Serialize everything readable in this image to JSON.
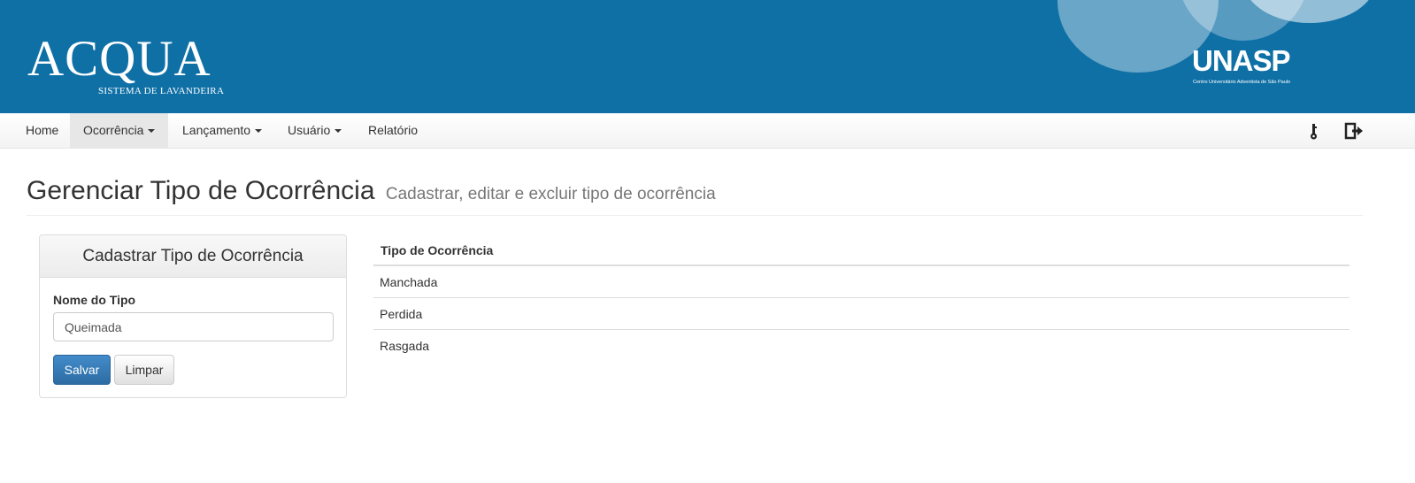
{
  "header": {
    "logo_title": "ACQUA",
    "logo_subtitle": "SISTEMA DE LAVANDEIRA",
    "partner_logo": "UNASP",
    "partner_caption": "Centro Universitário Adventista de São Paulo",
    "background_color": "#0f70a6"
  },
  "navbar": {
    "items": [
      {
        "label": "Home",
        "dropdown": false,
        "active": false
      },
      {
        "label": "Ocorrência",
        "dropdown": true,
        "active": true
      },
      {
        "label": "Lançamento",
        "dropdown": true,
        "active": false
      },
      {
        "label": "Usuário",
        "dropdown": true,
        "active": false
      },
      {
        "label": "Relatório",
        "dropdown": false,
        "active": false
      }
    ],
    "right_icons": [
      "key-icon",
      "logout-icon"
    ]
  },
  "page": {
    "title": "Gerenciar Tipo de Ocorrência",
    "subtitle": "Cadastrar, editar e excluir tipo de ocorrência"
  },
  "form_panel": {
    "heading": "Cadastrar Tipo de Ocorrência",
    "field_label": "Nome do Tipo",
    "field_value": "Queimada",
    "save_label": "Salvar",
    "clear_label": "Limpar",
    "primary_color": "#337ab7"
  },
  "table": {
    "header": "Tipo de Ocorrência",
    "rows": [
      "Manchada",
      "Perdida",
      "Rasgada"
    ]
  }
}
